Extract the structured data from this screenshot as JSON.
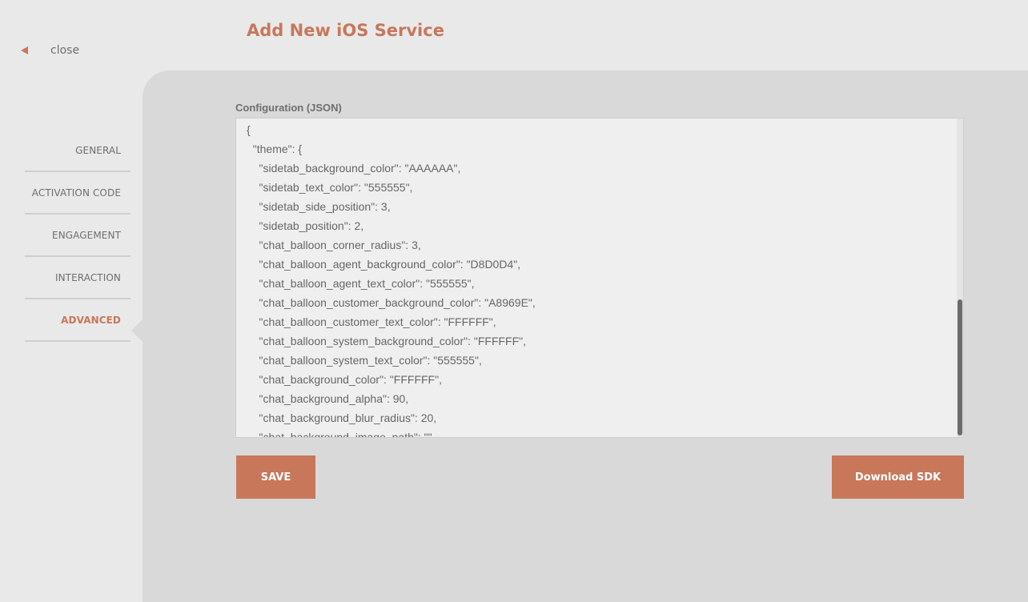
{
  "page": {
    "title": "Add New iOS Service",
    "close_label": "close"
  },
  "sidebar": {
    "items": [
      {
        "label": "GENERAL",
        "active": false
      },
      {
        "label": "ACTIVATION CODE",
        "active": false
      },
      {
        "label": "ENGAGEMENT",
        "active": false
      },
      {
        "label": "INTERACTION",
        "active": false
      },
      {
        "label": "ADVANCED",
        "active": true
      }
    ]
  },
  "config": {
    "label": "Configuration (JSON)",
    "lines": [
      "{",
      "  \"theme\": {",
      "    \"sidetab_background_color\": \"AAAAAA\",",
      "    \"sidetab_text_color\": \"555555\",",
      "    \"sidetab_side_position\": 3,",
      "    \"sidetab_position\": 2,",
      "    \"chat_balloon_corner_radius\": 3,",
      "    \"chat_balloon_agent_background_color\": \"D8D0D4\",",
      "    \"chat_balloon_agent_text_color\": \"555555\",",
      "    \"chat_balloon_customer_background_color\": \"A8969E\",",
      "    \"chat_balloon_customer_text_color\": \"FFFFFF\",",
      "    \"chat_balloon_system_background_color\": \"FFFFFF\",",
      "    \"chat_balloon_system_text_color\": \"555555\",",
      "    \"chat_background_color\": \"FFFFFF\",",
      "    \"chat_background_alpha\": 90,",
      "    \"chat_background_blur_radius\": 20,",
      "    \"chat_background_image_path\": \"\","
    ]
  },
  "actions": {
    "save_label": "SAVE",
    "download_label": "Download SDK"
  },
  "colors": {
    "accent": "#c8775b",
    "page_background": "#e9e9e9",
    "panel_background": "#d9d9d9",
    "editor_background": "#efefef",
    "text": "#6e6e6e"
  },
  "icons": {
    "close": "close-icon"
  }
}
